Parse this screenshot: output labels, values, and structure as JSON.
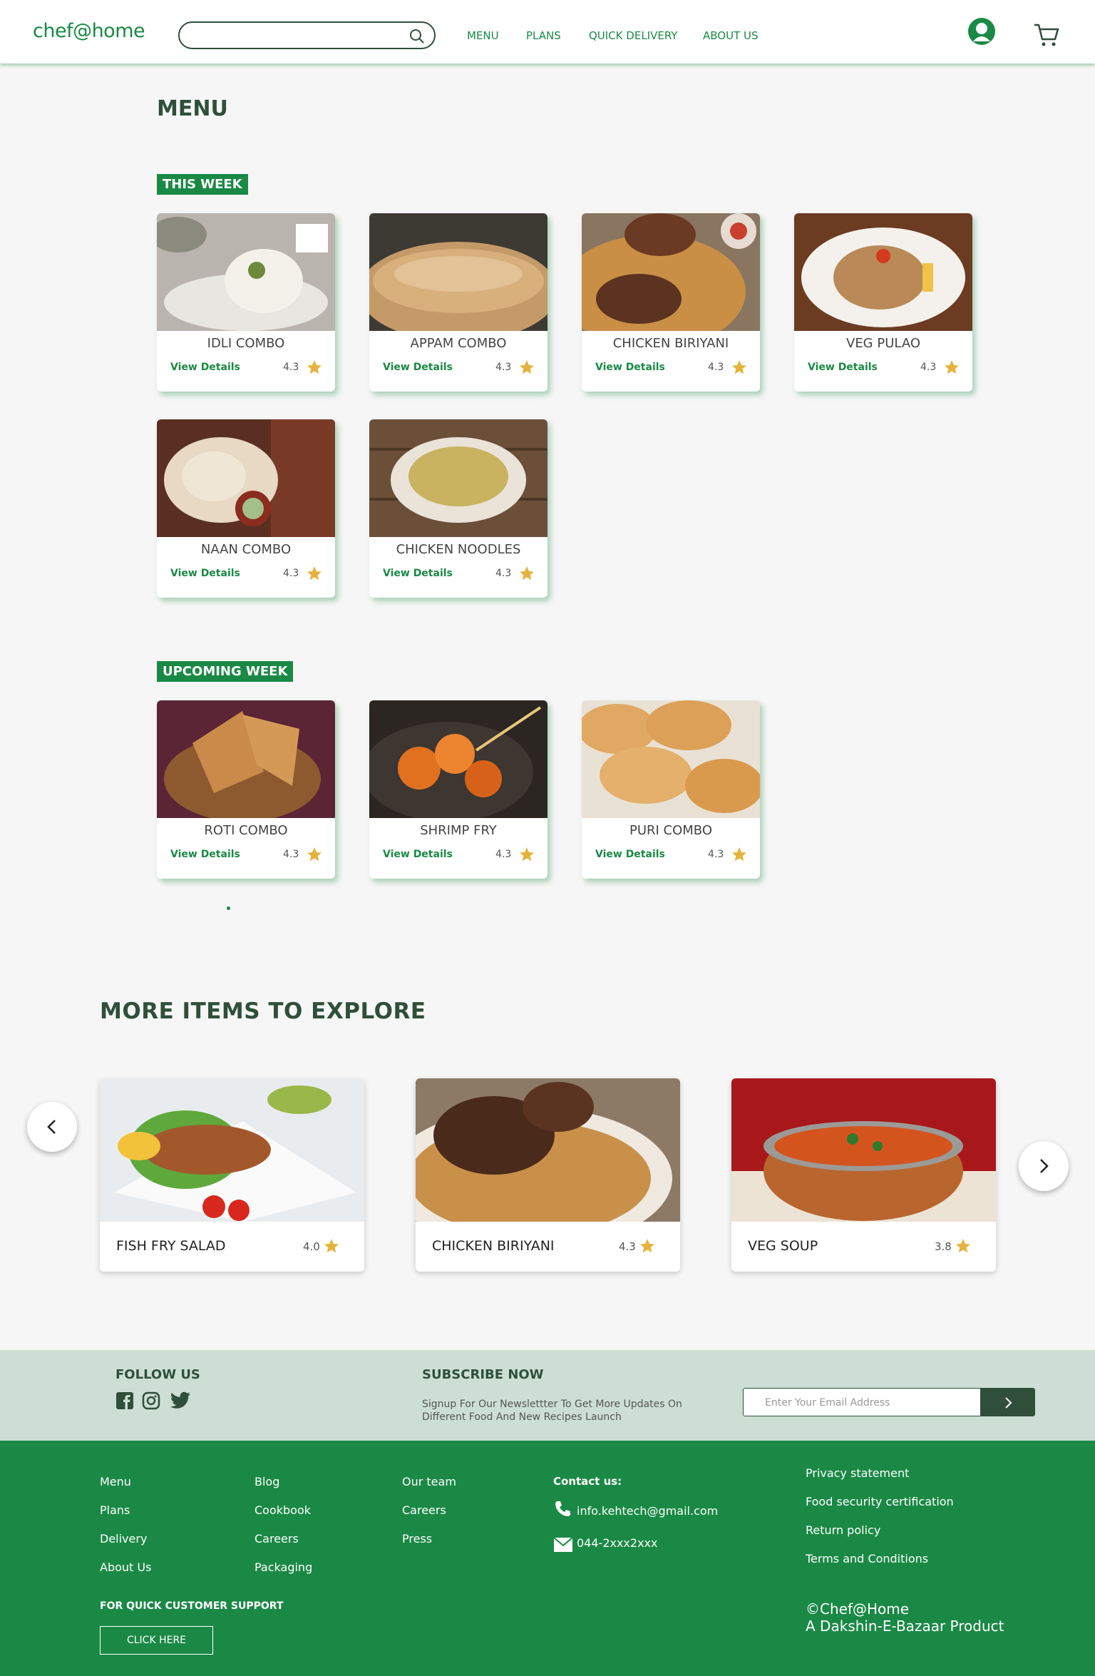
{
  "header": {
    "logo": "chef@home",
    "search_placeholder": "",
    "nav": [
      "MENU",
      "PLANS",
      "QUICK DELIVERY",
      "ABOUT US"
    ]
  },
  "menu": {
    "title": "MENU",
    "this_week_label": "THIS WEEK",
    "upcoming_label": "UPCOMING WEEK",
    "view_details_label": "View Details",
    "this_week": [
      {
        "name": "IDLI COMBO",
        "rating": "4.3"
      },
      {
        "name": "APPAM COMBO",
        "rating": "4.3"
      },
      {
        "name": "CHICKEN BIRIYANI",
        "rating": "4.3"
      },
      {
        "name": "VEG PULAO",
        "rating": "4.3"
      },
      {
        "name": "NAAN COMBO",
        "rating": "4.3"
      },
      {
        "name": "CHICKEN NOODLES",
        "rating": "4.3"
      }
    ],
    "upcoming": [
      {
        "name": "ROTI COMBO",
        "rating": "4.3"
      },
      {
        "name": "SHRIMP FRY",
        "rating": "4.3"
      },
      {
        "name": "PURI COMBO",
        "rating": "4.3"
      }
    ]
  },
  "explore": {
    "title": "MORE ITEMS TO EXPLORE",
    "items": [
      {
        "name": "FISH FRY SALAD",
        "rating": "4.0"
      },
      {
        "name": "CHICKEN BIRIYANI",
        "rating": "4.3"
      },
      {
        "name": "VEG SOUP",
        "rating": "3.8"
      }
    ]
  },
  "subscribe": {
    "follow_label": "FOLLOW US",
    "subscribe_label": "SUBSCRIBE NOW",
    "text": "Signup For Our Newslettter To Get More Updates On Different Food And New Recipes Launch",
    "email_placeholder": "Enter Your Email Address"
  },
  "footer": {
    "col1": [
      "Menu",
      "Plans",
      "Delivery",
      "About Us"
    ],
    "col2": [
      "Blog",
      "Cookbook",
      "Careers",
      "Packaging"
    ],
    "col3": [
      "Our team",
      "Careers",
      "Press"
    ],
    "contact_label": "Contact us:",
    "email": "info.kehtech@gmail.com",
    "phone": "044-2xxx2xxx",
    "legal": [
      "Privacy statement",
      "Food security certification",
      "Return policy",
      "Terms and Conditions"
    ],
    "support_label": "FOR QUICK CUSTOMER SUPPORT",
    "click_label": "CLICK HERE",
    "copyright_line1": "©Chef@Home",
    "copyright_line2": "A Dakshin-E-Bazaar Product"
  },
  "colors": {
    "brand": "#1a8945",
    "dark": "#2f4f3a",
    "star": "#e5b33d",
    "band": "#cddfd4"
  }
}
